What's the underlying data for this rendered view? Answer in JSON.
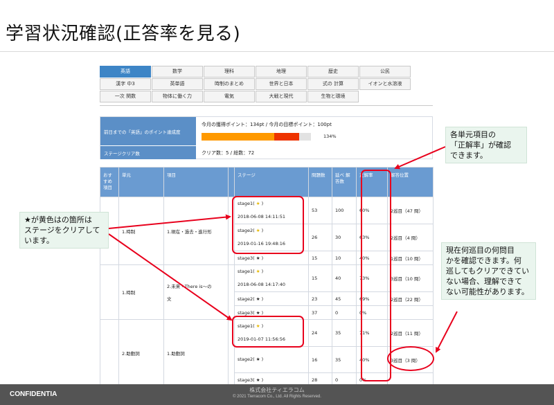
{
  "slide": {
    "title": "学習状況確認(正答率を見る)"
  },
  "tabs": {
    "rows": [
      [
        "英語",
        "数学",
        "理科",
        "地理",
        "歴史",
        "公民"
      ],
      [
        "漢字 中3",
        "英単語",
        "時制のまとめ",
        "世界と日本",
        "式の 計算",
        "イオンと水溶液"
      ],
      [
        "一次 関数",
        "物体に働く力",
        "電気",
        "大戦と現代",
        "生物と環境"
      ]
    ],
    "active": "英語"
  },
  "points": {
    "row1_label": "前日までの「英語」のポイント達成度",
    "current_points": "今月の獲得ポイント：134pt",
    "separator": "/",
    "target_points": "今月の目標ポイント：100pt",
    "progress_percent": "134%",
    "progress_value": 134,
    "row2_label": "ステージクリア数",
    "clear_count": "クリア数：5 / 総数：72"
  },
  "table": {
    "headers": {
      "recommended": "おす すめ 項目",
      "unit": "単元",
      "item": "項目",
      "stage": "ステージ",
      "questions": "問題数",
      "total_answers": "延べ 解答数",
      "accuracy": "正解率",
      "answer_position": "解答位置"
    },
    "unit_1": {
      "unit": "1.時制",
      "item": "1.現在・過去・進行形",
      "stage1_name": "stage1( ",
      "stage1_star": "★",
      "stage1_date": "2018-06-08 14:11:51",
      "stage1_questions": "53",
      "stage1_answers": "100",
      "stage1_rate": "60%",
      "stage1_pos": "2巡目（47 問）",
      "stage2_name": "stage2( ",
      "stage2_star": "★",
      "stage2_date": "2019-01-16 19:48:16",
      "stage2_questions": "26",
      "stage2_answers": "30",
      "stage2_rate": "63%",
      "stage2_pos": "2巡目（4 問）",
      "stage3_name": "stage3( ",
      "stage3_star": "★",
      "stage3_questions": "15",
      "stage3_answers": "10",
      "stage3_rate": "40%",
      "stage3_pos": "1巡目（10 問）"
    },
    "unit_2": {
      "unit": "1.時制",
      "item_line1": "2.未来・There is～の",
      "item_line2": "文",
      "stage1_name": "stage1( ",
      "stage1_star": "★",
      "stage1_date": "2018-06-08 14:17:40",
      "stage1_questions": "15",
      "stage1_answers": "40",
      "stage1_rate": "73%",
      "stage1_pos": "3巡目（10 問）",
      "stage2_name": "stage2( ",
      "stage2_star": "★",
      "stage2_questions": "23",
      "stage2_answers": "45",
      "stage2_rate": "69%",
      "stage2_pos": "2巡目（22 問）",
      "stage3_name": "stage3( ",
      "stage3_star": "★",
      "stage3_questions": "37",
      "stage3_answers": "0",
      "stage3_rate": "0%",
      "stage3_pos": ""
    },
    "unit_3": {
      "unit": "2.助動詞",
      "item": "1.助動詞",
      "stage1_name": "stage1( ",
      "stage1_star": "★",
      "stage1_date": "2019-01-07 11:56:56",
      "stage1_questions": "24",
      "stage1_answers": "35",
      "stage1_rate": "71%",
      "stage1_pos": "2巡目（11 問）",
      "stage2_name": "stage2( ",
      "stage2_star": "★",
      "stage2_questions": "16",
      "stage2_answers": "35",
      "stage2_rate": "40%",
      "stage2_pos": "3巡目（3 問）",
      "stage3_name": "stage3( ",
      "stage3_star": "★",
      "stage3_questions": "28",
      "stage3_answers": "0",
      "stage3_rate": "0%",
      "stage3_pos": ""
    },
    "close_paren": " )"
  },
  "annotations": {
    "accuracy_note": "各単元項目の「正解率」が確認できます。",
    "accuracy_note_l1": "各単元項目の",
    "accuracy_note_l2": "「正解率」が確認",
    "accuracy_note_l3": "できます。",
    "star_note_l1": "★が黄色はの箇所は",
    "star_note_l2": "ステージをクリアして",
    "star_note_l3": "います。",
    "position_note_l1": "現在何巡目の何問目",
    "position_note_l2": "かを確認できます。何",
    "position_note_l3": "巡してもクリアできてい",
    "position_note_l4": "ない場合、理解できて",
    "position_note_l5": "ない可能性があります。",
    "highlight_color": "#e8001c",
    "callout_bg": "#eaf5ee"
  },
  "footer": {
    "confidential": "CONFIDENTIA",
    "company": "株式会社ティエラコム",
    "copyright": "© 2021 Tierracom Co., Ltd. All Rights Reserved."
  },
  "colors": {
    "tab_active": "#3d85c6",
    "header_blue": "#6a9bd1",
    "bar_orange": "#ff9900",
    "bar_red": "#ee3300",
    "star_yellow": "#e6b800"
  }
}
